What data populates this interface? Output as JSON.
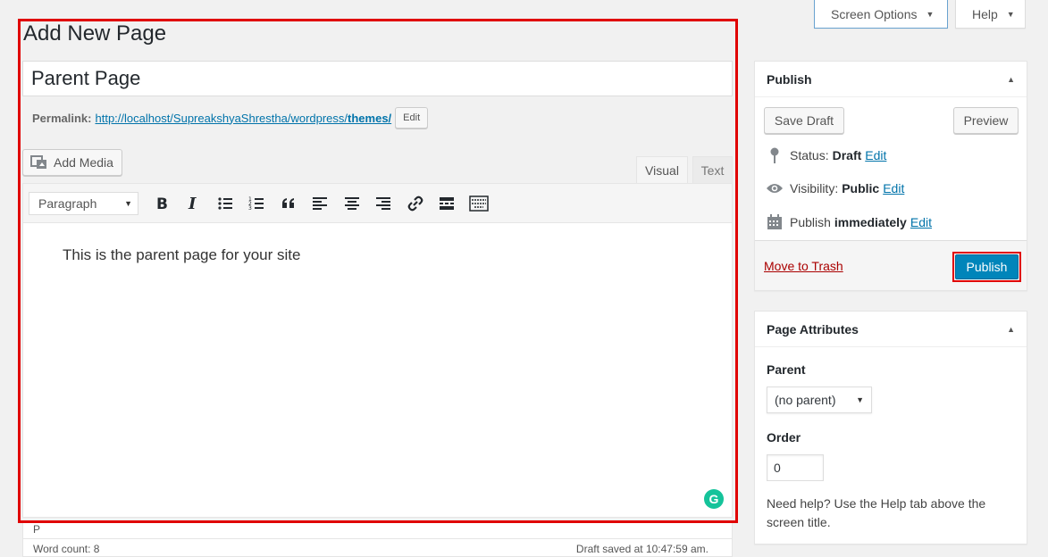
{
  "header": {
    "screen_options_label": "Screen Options",
    "help_label": "Help",
    "page_title": "Add New Page"
  },
  "post": {
    "title_value": "Parent Page",
    "permalink_label": "Permalink:",
    "permalink_base": "http://localhost/SupreakshyaShrestha/wordpress/",
    "permalink_slug": "themes/",
    "permalink_edit_label": "Edit"
  },
  "editor": {
    "add_media_label": "Add Media",
    "tabs": [
      {
        "label": "Visual",
        "active": true
      },
      {
        "label": "Text",
        "active": false
      }
    ],
    "format_select_value": "Paragraph",
    "toolbar_icons": [
      "bold-icon",
      "italic-icon",
      "bullet-list-icon",
      "numbered-list-icon",
      "blockquote-icon",
      "align-left-icon",
      "align-center-icon",
      "align-right-icon",
      "link-icon",
      "read-more-icon",
      "toolbar-toggle-icon"
    ],
    "content": "This is the parent page for your site",
    "grammarly_letter": "G",
    "path": "P",
    "word_count": "Word count: 8",
    "draft_saved": "Draft saved at 10:47:59 am."
  },
  "publish_box": {
    "title": "Publish",
    "save_draft_label": "Save Draft",
    "preview_label": "Preview",
    "status_label": "Status:",
    "status_value": "Draft",
    "visibility_label": "Visibility:",
    "visibility_value": "Public",
    "publish_label": "Publish",
    "publish_value": "immediately",
    "edit_label": "Edit",
    "trash_label": "Move to Trash",
    "publish_button_label": "Publish"
  },
  "attributes_box": {
    "title": "Page Attributes",
    "parent_label": "Parent",
    "parent_value": "(no parent)",
    "order_label": "Order",
    "order_value": "0",
    "help_text": "Need help? Use the Help tab above the screen title."
  },
  "colors": {
    "accent": "#0085ba",
    "annotation": "#e00000",
    "link": "#0073aa",
    "trash": "#aa0000"
  }
}
